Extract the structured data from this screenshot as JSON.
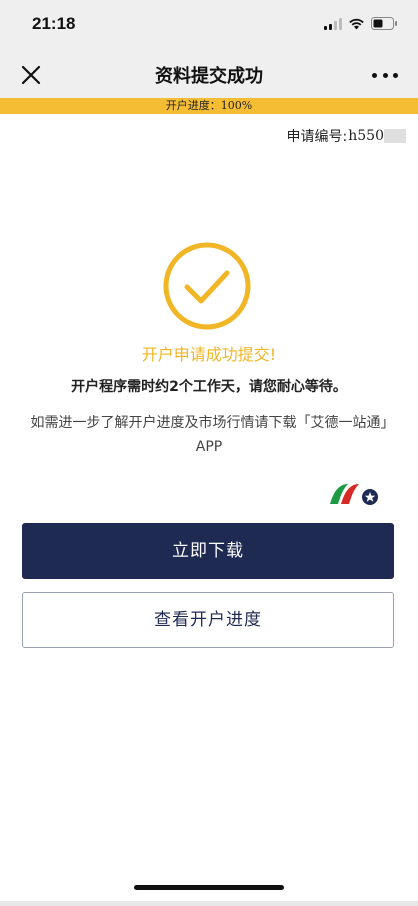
{
  "status_bar": {
    "time": "21:18",
    "icons": [
      "signal-icon",
      "wifi-icon",
      "battery-icon"
    ]
  },
  "nav": {
    "title": "资料提交成功",
    "close_icon": "close-icon",
    "more_icon": "more-icon"
  },
  "progress": {
    "label": "开户进度：100%",
    "value_percent": 100,
    "color": "#f5bd33"
  },
  "application": {
    "label": "申请编号:",
    "value": "h550"
  },
  "result": {
    "icon": "check-circle-icon",
    "title": "开户申请成功提交!",
    "subtitle": "开户程序需时约2个工作天，请您耐心等待。",
    "description": "如需进一步了解开户进度及市场行情请下载「艾德一站通」APP"
  },
  "brand": {
    "logo": "eddid-logo"
  },
  "buttons": {
    "download": "立即下载",
    "view_progress": "查看开户进度"
  },
  "colors": {
    "accent": "#f0b625",
    "primary": "#1f2a52",
    "logo_green": "#1f9b45",
    "logo_red": "#d62a26",
    "logo_navy": "#1f2a52"
  }
}
